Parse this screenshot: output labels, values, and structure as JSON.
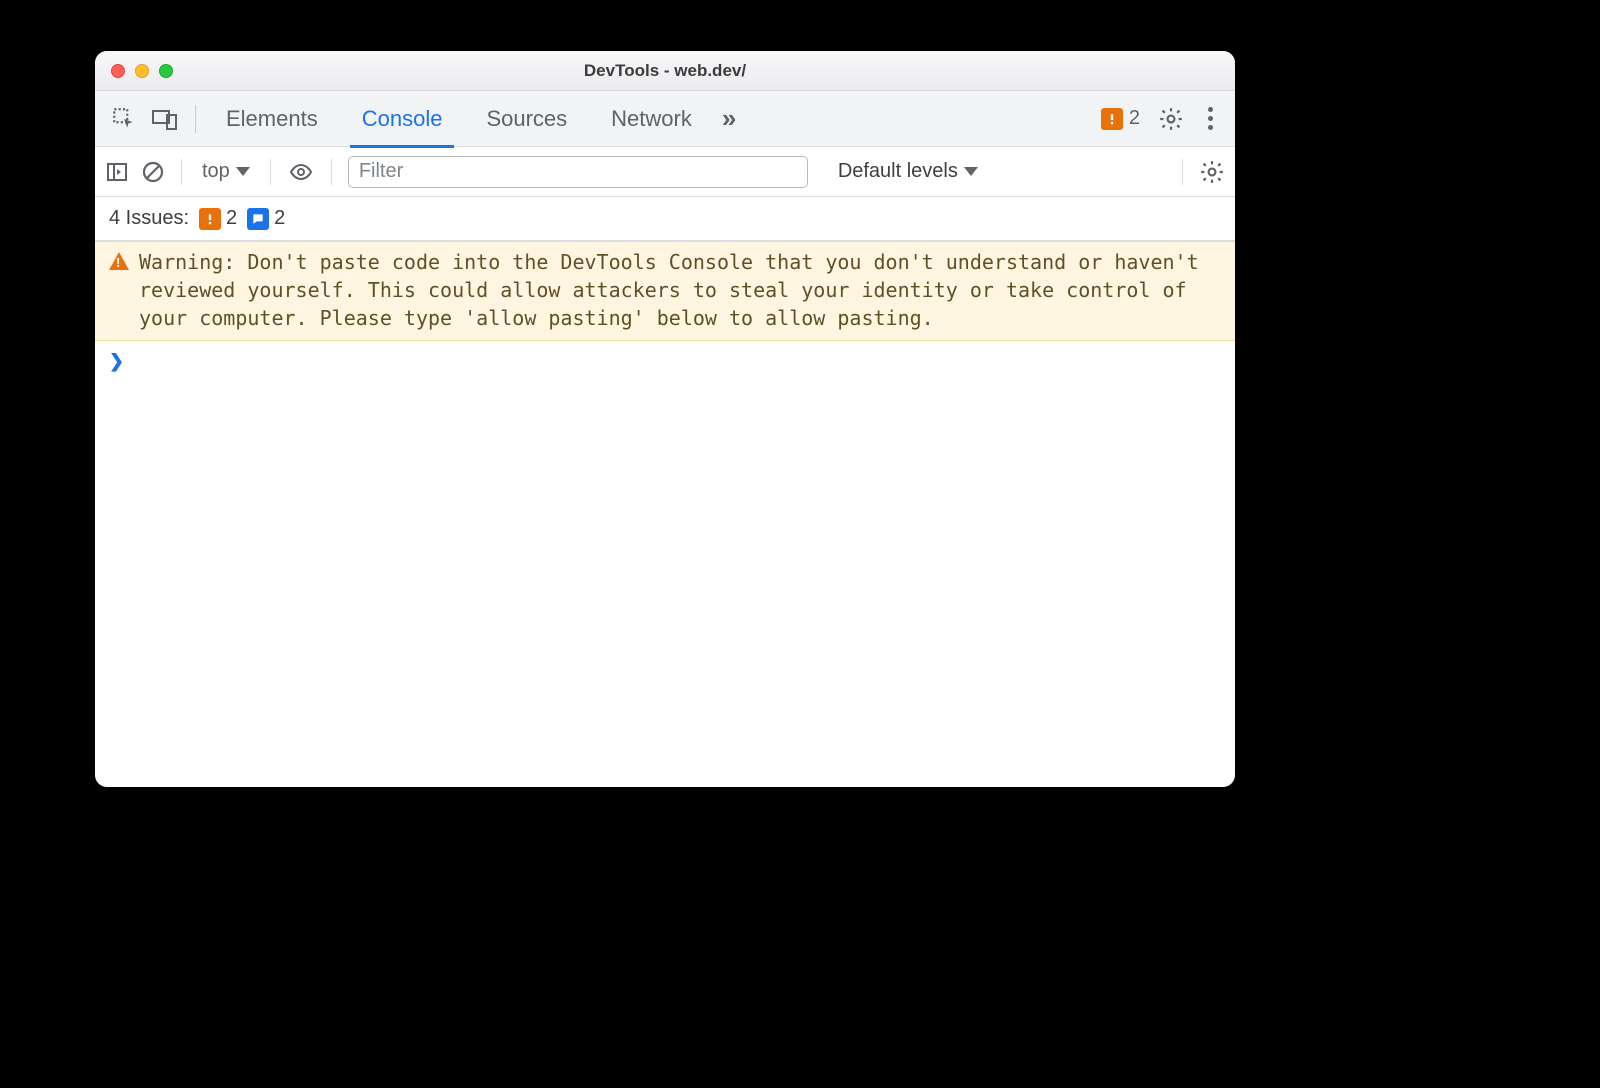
{
  "window": {
    "title": "DevTools - web.dev/"
  },
  "tabs": {
    "elements": "Elements",
    "console": "Console",
    "sources": "Sources",
    "network": "Network"
  },
  "topbar_issue_count": "2",
  "console_toolbar": {
    "context": "top",
    "filter_placeholder": "Filter",
    "levels_label": "Default levels"
  },
  "issues": {
    "label": "4 Issues:",
    "orange_count": "2",
    "blue_count": "2"
  },
  "warning": "Warning: Don't paste code into the DevTools Console that you don't understand or haven't reviewed yourself. This could allow attackers to steal your identity or take control of your computer. Please type 'allow pasting' below to allow pasting."
}
